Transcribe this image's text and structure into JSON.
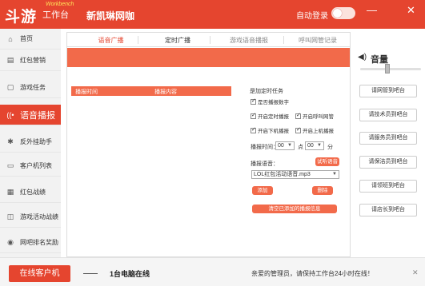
{
  "titlebar": {
    "logo": "斗游",
    "logo_sub": "工作台",
    "logo_badge": "Workbench",
    "shop_name": "新凯琳网咖",
    "autologin_label": "自动登录",
    "minimize": "—",
    "close": "✕"
  },
  "sidebar": {
    "items": [
      {
        "label": "首页",
        "icon": "home-icon",
        "glyph": "⌂"
      },
      {
        "label": "红包营销",
        "icon": "red-envelope-icon",
        "glyph": "▤"
      },
      {
        "label": "游戏任务",
        "icon": "task-icon",
        "glyph": "▢"
      },
      {
        "label": "语音播报",
        "icon": "broadcast-icon",
        "glyph": "((•"
      },
      {
        "label": "反外挂助手",
        "icon": "gamepad-icon",
        "glyph": "✱"
      },
      {
        "label": "客户机列表",
        "icon": "list-icon",
        "glyph": "▭"
      },
      {
        "label": "红包战绩",
        "icon": "record-icon",
        "glyph": "▦"
      },
      {
        "label": "游戏活动战绩",
        "icon": "activity-icon",
        "glyph": "◫"
      },
      {
        "label": "网吧排名奖励",
        "icon": "trophy-icon",
        "glyph": "◉"
      }
    ],
    "active_index": 3
  },
  "main": {
    "tabs": [
      "语音广播",
      "定时广播",
      "游戏语音播报",
      "呼叫网管记录"
    ],
    "active_tab": 1,
    "table_headers": [
      "播报时间",
      "播报内容"
    ],
    "task": {
      "title": "是加定时任务",
      "only_number_label": "是否播报数字",
      "options": [
        "开启定时播报",
        "开启呼叫网管",
        "开启下机播报",
        "开启上机播报"
      ],
      "time_label": "播报时间：",
      "hour": "00",
      "point_label": "点",
      "minute": "00",
      "minute_label": "分",
      "voice_label": "播报语音：",
      "try_button": "试听语音",
      "voice_file": "LOL红包活动语音.mp3",
      "add_button": "添加",
      "delete_button": "删除",
      "clear_button": "清空已添加的播报信息"
    }
  },
  "volume": {
    "label": "音量",
    "level": 0.45
  },
  "quick_buttons": [
    "请网管到吧台",
    "请技术员到吧台",
    "请服务员到吧台",
    "请保洁员到吧台",
    "请领班到吧台",
    "请店长到吧台"
  ],
  "footer": {
    "online_button": "在线客户机",
    "pc_count": "1台电脑在线",
    "welcome": "亲爱的管理员，请保持工作台24小时在线！",
    "close": "✕"
  }
}
